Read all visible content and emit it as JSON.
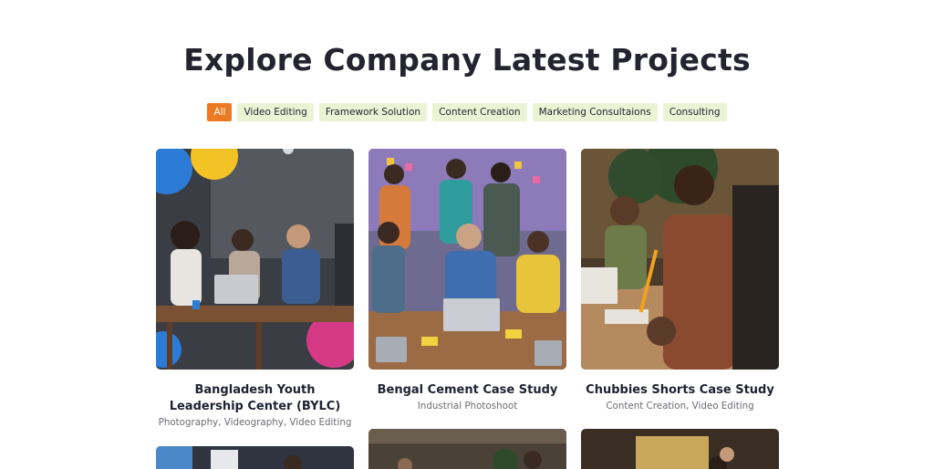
{
  "page": {
    "title": "Explore Company Latest Projects"
  },
  "filters": [
    {
      "label": "All",
      "active": true
    },
    {
      "label": "Video Editing",
      "active": false
    },
    {
      "label": "Framework Solution",
      "active": false
    },
    {
      "label": "Content Creation",
      "active": false
    },
    {
      "label": "Marketing Consultaions",
      "active": false
    },
    {
      "label": "Consulting",
      "active": false
    }
  ],
  "projects": [
    {
      "title": "Bangladesh Youth Leadership Center (BYLC)",
      "tags": "Photography, Videography, Video Editing"
    },
    {
      "title": "Bengal Cement Case Study",
      "tags": "Industrial Photoshoot"
    },
    {
      "title": "Chubbies Shorts Case Study",
      "tags": "Content Creation, Video Editing"
    }
  ],
  "colors": {
    "accent": "#ec7a23",
    "chip_bg": "#eaf3d4"
  }
}
